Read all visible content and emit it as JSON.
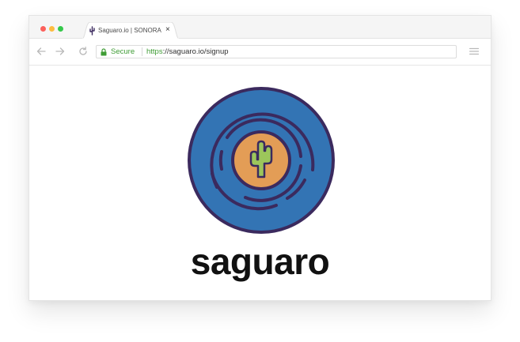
{
  "browser": {
    "tab": {
      "title": "Saguaro.io | SONORA",
      "close_glyph": "×",
      "favicon": "cactus-icon"
    },
    "toolbar": {
      "back_icon": "arrow-left-icon",
      "forward_icon": "arrow-right-icon",
      "reload_icon": "reload-icon",
      "menu_icon": "hamburger-menu-icon"
    },
    "address_bar": {
      "security_icon": "lock-icon",
      "secure_label": "Secure",
      "url_scheme": "https",
      "url_rest": "://saguaro.io/signup"
    }
  },
  "page": {
    "logo": {
      "icon": "vinyl-record-cactus-icon",
      "colors": {
        "outline": "#3b2a5e",
        "disc": "#3374b4",
        "label": "#e39d56",
        "cactus": "#9cc65b"
      }
    },
    "brand_name": "saguaro"
  },
  "colors": {
    "secure_green": "#3f9c35",
    "traffic_red": "#fc605b",
    "traffic_yellow": "#fdbc40",
    "traffic_green": "#34c84a"
  }
}
